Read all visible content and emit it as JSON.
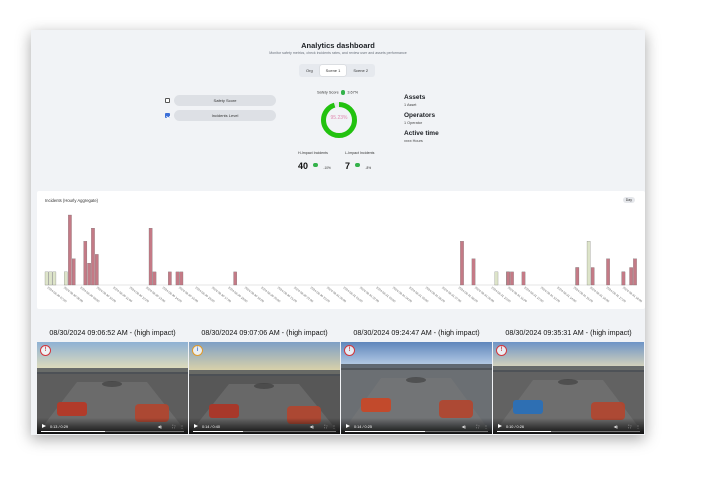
{
  "header": {
    "title": "Analytics dashboard",
    "subtitle": "Monitor safety metrics, check incidents rates, and review user and assets performance"
  },
  "tabs": [
    {
      "label": "Org",
      "active": false
    },
    {
      "label": "Scene 1",
      "active": true
    },
    {
      "label": "Scene 2",
      "active": false
    }
  ],
  "toggles": [
    {
      "label": "Safety Score",
      "checked": false
    },
    {
      "label": "Incidents Level",
      "checked": true
    }
  ],
  "safety": {
    "label": "Safety Score",
    "change": "3.67%",
    "value": "95.23%",
    "fraction": 0.9523,
    "ring_color": "#22c20f",
    "text_color": "#e08ab0"
  },
  "impact": {
    "high": {
      "label": "H-Impact Incidents",
      "value": "40",
      "change": "-10%"
    },
    "low": {
      "label": "L-Impact Incidents",
      "value": "7",
      "change": "-8%"
    }
  },
  "stats": [
    {
      "title": "Assets",
      "value": "1 Asset"
    },
    {
      "title": "Operators",
      "value": "1 Operator"
    },
    {
      "title": "Active time",
      "value": "xxxx Hours"
    }
  ],
  "chart_data": {
    "type": "bar",
    "title": "Incidents (Hourly Aggregate)",
    "badge": "Day",
    "colors": {
      "high": "#c47a86",
      "low": "#dde4c9"
    },
    "series": [
      {
        "values_high": [
          0,
          0,
          0,
          0,
          0,
          0,
          16,
          6,
          0,
          0,
          10,
          5,
          13,
          7,
          0,
          0,
          0,
          0,
          0,
          0,
          0,
          0,
          0,
          0,
          0,
          0,
          0,
          13,
          3,
          0,
          0,
          0,
          3,
          0,
          3,
          3,
          0,
          0,
          0,
          0,
          0,
          0,
          0,
          0,
          0,
          0,
          0,
          0,
          0,
          3,
          0,
          0,
          0,
          0,
          0,
          0,
          0,
          0,
          0,
          0,
          0,
          0,
          0,
          0,
          0,
          0,
          0,
          0,
          0,
          0,
          0,
          0,
          0,
          0,
          0,
          0,
          0,
          0,
          0,
          0,
          0,
          0,
          0,
          0,
          0,
          0,
          0,
          0,
          0,
          0,
          0,
          0,
          0,
          0,
          0,
          0,
          0,
          0,
          0,
          0,
          0,
          0,
          0,
          0,
          0,
          0,
          0,
          0,
          10,
          0,
          0,
          6,
          0,
          0,
          0,
          0,
          0,
          0,
          0,
          0,
          3,
          3,
          0,
          0,
          3,
          0,
          0,
          0,
          0,
          0,
          0,
          0,
          0,
          0,
          0,
          0,
          0,
          0,
          4,
          0,
          0,
          0,
          4,
          0,
          0,
          0,
          6,
          0,
          0,
          0,
          3,
          0,
          4,
          6
        ]
      },
      {
        "values_low": [
          3,
          3,
          3,
          0,
          0,
          3,
          0,
          0,
          0,
          0,
          0,
          0,
          0,
          0,
          0,
          0,
          0,
          0,
          0,
          0,
          0,
          0,
          0,
          0,
          0,
          0,
          0,
          0,
          0,
          0,
          0,
          0,
          0,
          0,
          0,
          0,
          0,
          0,
          0,
          0,
          0,
          0,
          0,
          0,
          0,
          0,
          0,
          0,
          0,
          0,
          0,
          0,
          0,
          0,
          0,
          0,
          0,
          0,
          0,
          0,
          0,
          0,
          0,
          0,
          0,
          0,
          0,
          0,
          0,
          0,
          0,
          0,
          0,
          0,
          0,
          0,
          0,
          0,
          0,
          0,
          0,
          0,
          0,
          0,
          0,
          0,
          0,
          0,
          0,
          0,
          0,
          0,
          0,
          0,
          0,
          0,
          0,
          0,
          0,
          0,
          0,
          0,
          0,
          0,
          0,
          0,
          0,
          0,
          0,
          0,
          0,
          0,
          0,
          0,
          0,
          0,
          0,
          3,
          0,
          0,
          3,
          0,
          0,
          0,
          0,
          0,
          0,
          0,
          0,
          0,
          0,
          0,
          0,
          0,
          0,
          0,
          0,
          0,
          4,
          0,
          0,
          10,
          0,
          0,
          0,
          0,
          0,
          0,
          0,
          0,
          3,
          0,
          0,
          0,
          0,
          0,
          0,
          0,
          0,
          0
        ]
      }
    ],
    "ylim": [
      0,
      16
    ],
    "x_labels": [
      "2024-08-30 07:00",
      "2024-08-30 08:00",
      "2024-08-30 09:00",
      "2024-08-30 10:00",
      "2024-08-30 11:00",
      "2024-08-30 12:00",
      "2024-08-30 13:00",
      "2024-08-30 14:00",
      "2024-08-30 15:00",
      "2024-08-30 16:00",
      "2024-08-30 17:00",
      "2024-08-30 18:00",
      "2024-08-30 19:00",
      "2024-08-30 20:00",
      "2024-08-30 21:00",
      "2024-08-30 22:00",
      "2024-08-30 23:00",
      "2024-08-31 00:00",
      "2024-08-31 01:00",
      "2024-08-31 02:00",
      "2024-08-31 03:00",
      "2024-08-31 04:00",
      "2024-08-31 05:00",
      "2024-08-31 06:00",
      "2024-08-31 07:00",
      "2024-08-31 08:00",
      "2024-08-31 09:00",
      "2024-08-31 10:00",
      "2024-08-31 11:00",
      "2024-08-31 12:00",
      "2024-08-31 13:00",
      "2024-08-31 14:00",
      "2024-08-31 15:00",
      "2024-08-31 16:00",
      "2024-08-31 17:00",
      "2024-08-31 18:00"
    ]
  },
  "videos": [
    {
      "title": "08/30/2024 09:06:52 AM - (high impact)",
      "time": "0:13 / 0:29",
      "icon": "alert-icon",
      "progress": 0.45
    },
    {
      "title": "08/30/2024 09:07:06 AM - (high impact)",
      "time": "0:14 / 0:40",
      "icon": "info-icon",
      "progress": 0.35
    },
    {
      "title": "08/30/2024 09:24:47 AM - (high impact)",
      "time": "0:14 / 0:25",
      "icon": "alert-icon",
      "progress": 0.56
    },
    {
      "title": "08/30/2024 09:35:31 AM - (high impact)",
      "time": "0:10 / 0:26",
      "icon": "alert-icon",
      "progress": 0.38
    }
  ]
}
